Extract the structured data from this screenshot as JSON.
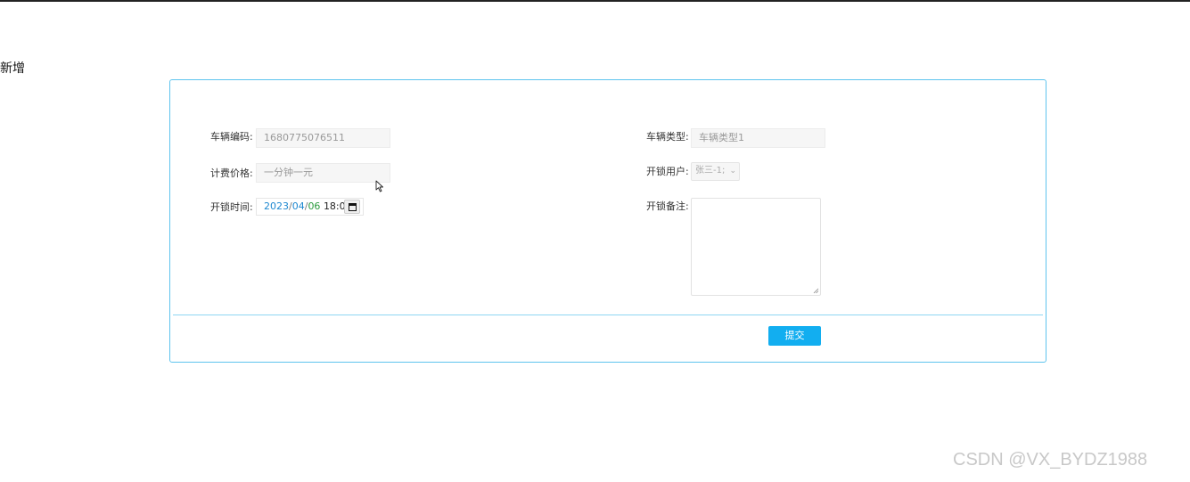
{
  "page": {
    "heading": "新增"
  },
  "form": {
    "vehicle_code": {
      "label": "车辆编码:",
      "value": "1680775076511"
    },
    "vehicle_type": {
      "label": "车辆类型:",
      "value": "车辆类型1"
    },
    "price": {
      "label": "计费价格:",
      "value": "一分钟一元"
    },
    "unlock_user": {
      "label": "开锁用户:",
      "value": "张三-1;"
    },
    "unlock_time": {
      "label": "开锁时间:",
      "year": "2023",
      "month": "04",
      "day": "06",
      "sep": "/",
      "time": "18:00"
    },
    "unlock_note": {
      "label": "开锁备注:",
      "value": ""
    },
    "submit_label": "提交"
  },
  "icons": {
    "calendar": "calendar-icon",
    "dropdown": "chevron-down-icon",
    "resize": "resize-grip-icon",
    "cursor": "mouse-pointer-icon"
  },
  "colors": {
    "card_border": "#5ec4ee",
    "submit_bg": "#12aef0",
    "field_bg": "#f6f6f6"
  },
  "watermark": "CSDN @VX_BYDZ1988"
}
